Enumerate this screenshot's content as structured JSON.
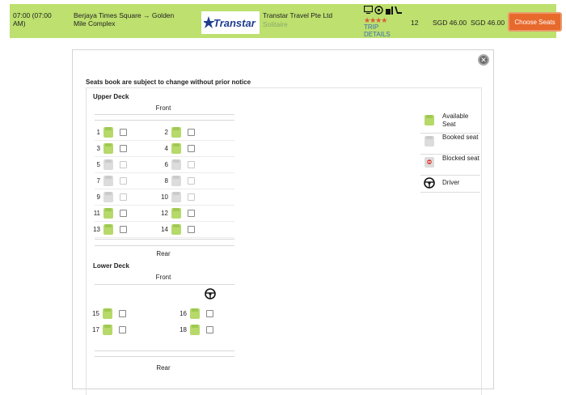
{
  "trip": {
    "departure_time": "07:00 (07:00 AM)",
    "route": "Berjaya Times Square → Golden Mile Complex",
    "logo_text": "Transtar",
    "operator": "Transtar Travel Pte Ltd",
    "coach_type": "Solitaire",
    "stars": "★★★★",
    "trip_details": "TRIP DETAILS",
    "seats_available": "12",
    "price_original": "SGD 46.00",
    "price_final": "SGD 46.00",
    "choose_label": "Choose Seats",
    "amenity_icons": [
      "tv-icon",
      "media-icon",
      "power-socket-icon",
      "reclining-seat-icon"
    ]
  },
  "modal": {
    "notice": "Seats book are subject to change without prior notice",
    "close_glyph": "✕",
    "upper_deck": {
      "title": "Upper Deck",
      "front": "Front",
      "rear": "Rear",
      "rows": [
        [
          {
            "num": "1",
            "status": "available"
          },
          {
            "num": "2",
            "status": "available"
          }
        ],
        [
          {
            "num": "3",
            "status": "available"
          },
          {
            "num": "4",
            "status": "available"
          }
        ],
        [
          {
            "num": "5",
            "status": "booked"
          },
          {
            "num": "6",
            "status": "booked"
          }
        ],
        [
          {
            "num": "7",
            "status": "booked"
          },
          {
            "num": "8",
            "status": "booked"
          }
        ],
        [
          {
            "num": "9",
            "status": "booked"
          },
          {
            "num": "10",
            "status": "booked"
          }
        ],
        [
          {
            "num": "11",
            "status": "available"
          },
          {
            "num": "12",
            "status": "available"
          }
        ],
        [
          {
            "num": "13",
            "status": "available"
          },
          {
            "num": "14",
            "status": "available"
          }
        ]
      ]
    },
    "lower_deck": {
      "title": "Lower Deck",
      "front": "Front",
      "rear": "Rear",
      "rows": [
        [
          {
            "num": "15",
            "status": "available"
          },
          {
            "num": "16",
            "status": "available"
          }
        ],
        [
          {
            "num": "17",
            "status": "available"
          },
          {
            "num": "18",
            "status": "available"
          }
        ]
      ]
    },
    "legend": [
      {
        "label": "Available Seat",
        "kind": "available"
      },
      {
        "label": "Booked seat",
        "kind": "booked"
      },
      {
        "label": "Blocked seat",
        "kind": "blocked"
      },
      {
        "label": "Driver",
        "kind": "driver"
      }
    ]
  },
  "colors": {
    "topbar": "#bde06e",
    "button": "#e8692c",
    "seat_available": "#b6d96a",
    "seat_booked": "#dcdcdc",
    "link": "#3a6fb0",
    "stars": "#e0573a"
  }
}
